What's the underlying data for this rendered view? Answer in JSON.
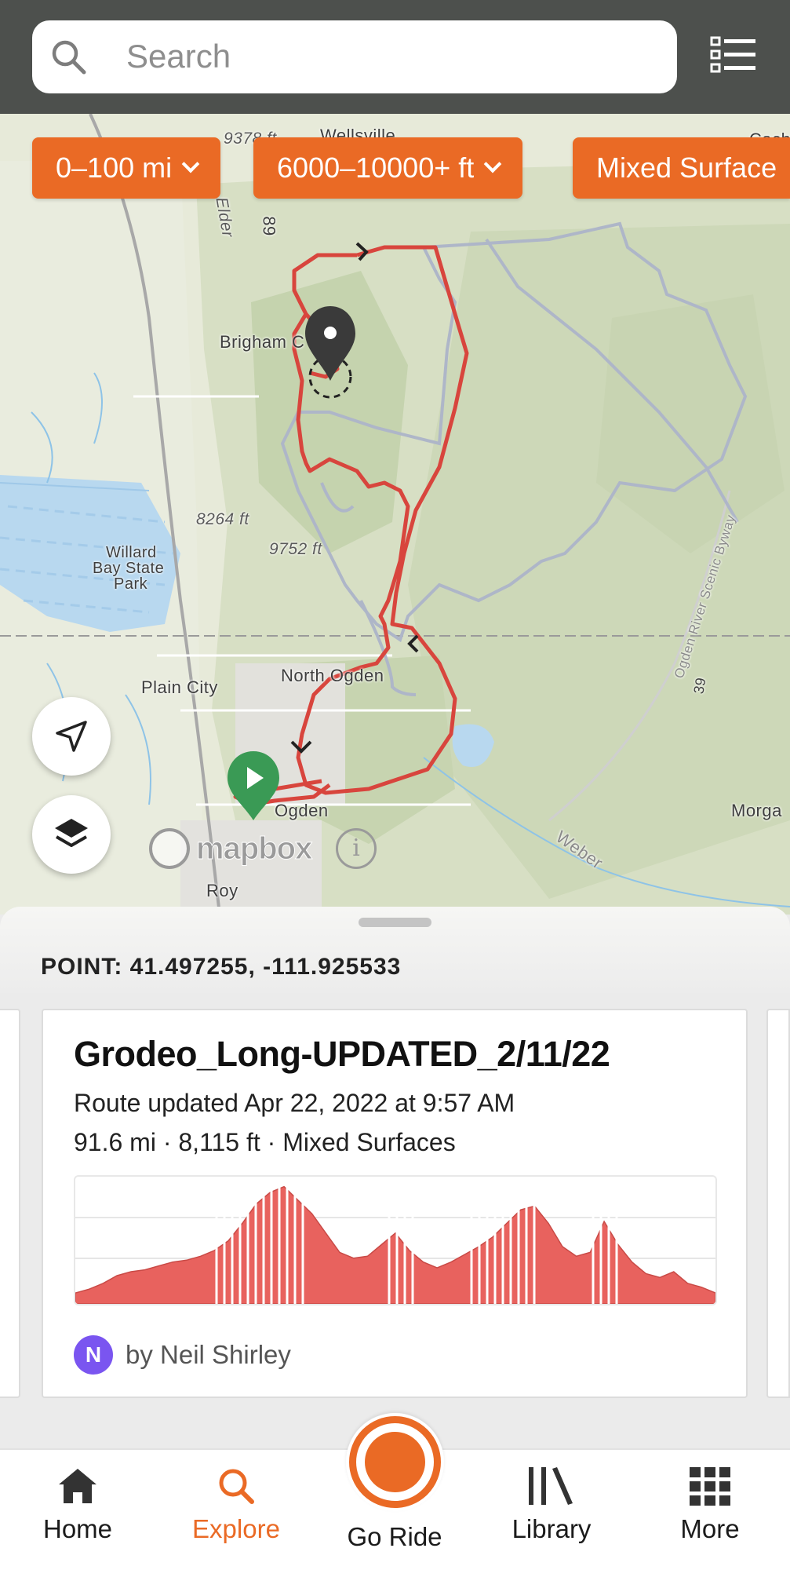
{
  "search": {
    "placeholder": "Search"
  },
  "filters": [
    {
      "label": "0–100 mi"
    },
    {
      "label": "6000–10000+ ft"
    },
    {
      "label": "Mixed Surface"
    }
  ],
  "map": {
    "labels": {
      "wellsville": "Wellsville",
      "brigham": "Brigham C",
      "willard": "Willard",
      "bay_state": "Bay State",
      "park": "Park",
      "plain_city": "Plain City",
      "north_ogden": "North Ogden",
      "ogden": "Ogden",
      "roy": "Roy",
      "morgan": "Morga",
      "weber": "Weber",
      "byway": "Ogden River Scenic Byway",
      "hwy39": "39",
      "hwy89": "89",
      "elder": "Elder",
      "cache": "Cache",
      "elev1": "8264 ft",
      "elev2": "9752 ft",
      "elev3": "9378 ft"
    },
    "attribution": "mapbox",
    "route_color": "#d8453d",
    "alt_route_color": "#aeb6c8"
  },
  "sheet": {
    "point": "POINT: 41.497255, -111.925533",
    "route": {
      "title": "Grodeo_Long-UPDATED_2/11/22",
      "updated": "Route updated Apr 22, 2022 at 9:57 AM",
      "meta": "91.6 mi · 8,115 ft · Mixed Surfaces",
      "author_initial": "N",
      "author": "by Neil Shirley",
      "elevation_profile": [
        8,
        12,
        18,
        26,
        30,
        32,
        36,
        40,
        42,
        46,
        52,
        62,
        80,
        100,
        112,
        118,
        104,
        90,
        70,
        50,
        44,
        46,
        58,
        70,
        52,
        40,
        34,
        40,
        48,
        56,
        66,
        80,
        94,
        98,
        80,
        56,
        46,
        50,
        82,
        58,
        40,
        28,
        24,
        30,
        18,
        14,
        8
      ]
    }
  },
  "tabs": [
    {
      "label": "Home",
      "icon": "home-icon"
    },
    {
      "label": "Explore",
      "icon": "search-icon"
    },
    {
      "label": "Go Ride",
      "icon": "record-icon"
    },
    {
      "label": "Library",
      "icon": "library-icon"
    },
    {
      "label": "More",
      "icon": "grid-icon"
    }
  ],
  "colors": {
    "accent": "#ea6a25",
    "topbar": "#4d504d",
    "avatar": "#7a55f0"
  }
}
